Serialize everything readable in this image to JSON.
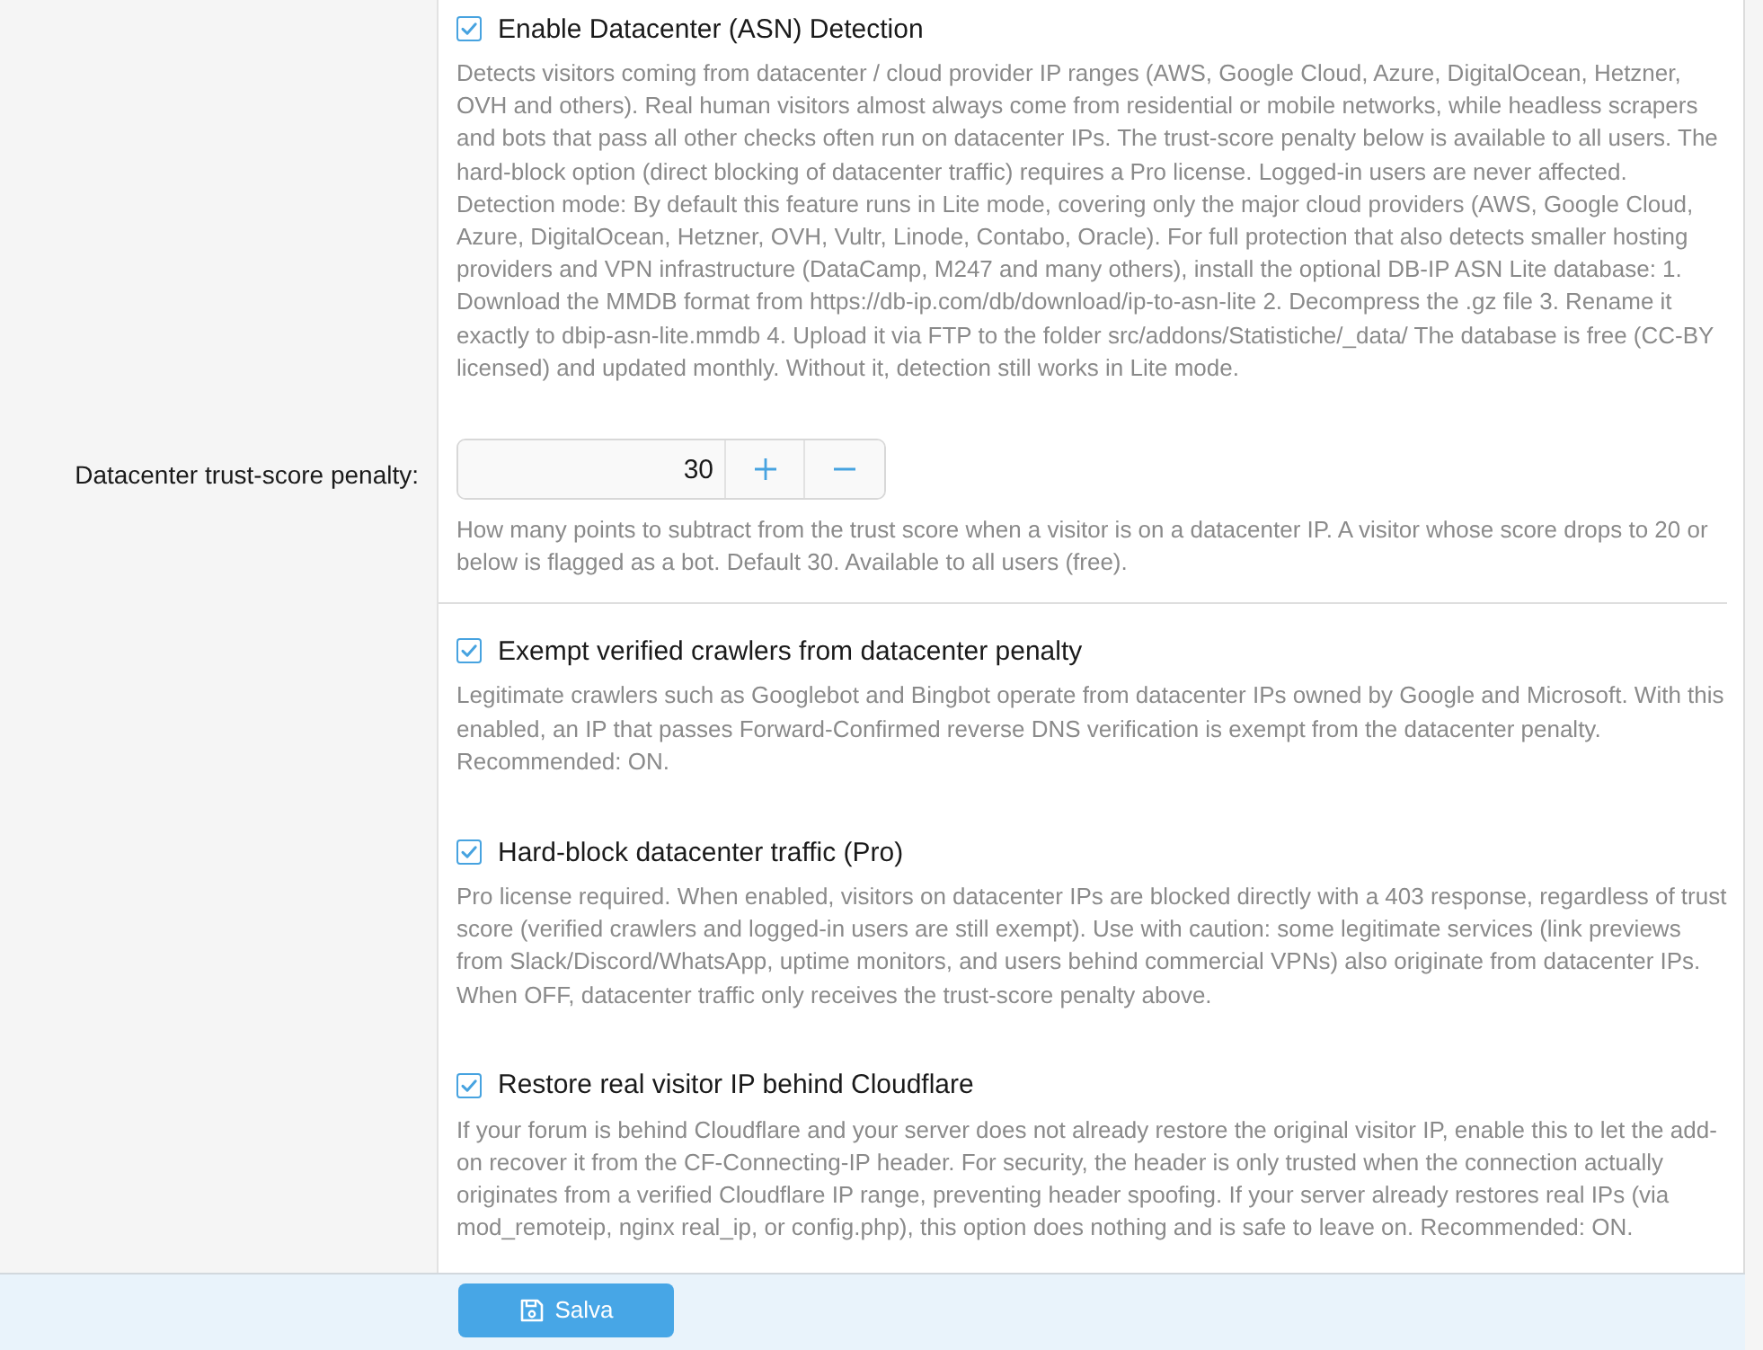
{
  "options": [
    {
      "kind": "checkbox",
      "label": "Enable Datacenter (ASN) Detection",
      "checked": true,
      "description": "Detects visitors coming from datacenter / cloud provider IP ranges (AWS, Google Cloud, Azure, DigitalOcean, Hetzner, OVH and others). Real human visitors almost always come from residential or mobile networks, while headless scrapers and bots that pass all other checks often run on datacenter IPs. The trust-score penalty below is available to all users. The hard-block option (direct blocking of datacenter traffic) requires a Pro license. Logged-in users are never affected. Detection mode: By default this feature runs in Lite mode, covering only the major cloud providers (AWS, Google Cloud, Azure, DigitalOcean, Hetzner, OVH, Vultr, Linode, Contabo, Oracle). For full protection that also detects smaller hosting providers and VPN infrastructure (DataCamp, M247 and many others), install the optional DB-IP ASN Lite database: 1. Download the MMDB format from https://db-ip.com/db/download/ip-to-asn-lite 2. Decompress the .gz file 3. Rename it exactly to dbip-asn-lite.mmdb 4. Upload it via FTP to the folder src/addons/Statistiche/_data/ The database is free (CC-BY licensed) and updated monthly. Without it, detection still works in Lite mode."
    },
    {
      "kind": "number",
      "label": "Datacenter trust-score penalty:",
      "value": "30",
      "description": "How many points to subtract from the trust score when a visitor is on a datacenter IP. A visitor whose score drops to 20 or below is flagged as a bot. Default 30. Available to all users (free)."
    },
    {
      "kind": "checkbox",
      "label": "Exempt verified crawlers from datacenter penalty",
      "checked": true,
      "description": "Legitimate crawlers such as Googlebot and Bingbot operate from datacenter IPs owned by Google and Microsoft. With this enabled, an IP that passes Forward-Confirmed reverse DNS verification is exempt from the datacenter penalty. Recommended: ON."
    },
    {
      "kind": "checkbox",
      "label": "Hard-block datacenter traffic (Pro)",
      "checked": true,
      "description": "Pro license required. When enabled, visitors on datacenter IPs are blocked directly with a 403 response, regardless of trust score (verified crawlers and logged-in users are still exempt). Use with caution: some legitimate services (link previews from Slack/Discord/WhatsApp, uptime monitors, and users behind commercial VPNs) also originate from datacenter IPs. When OFF, datacenter traffic only receives the trust-score penalty above."
    },
    {
      "kind": "checkbox",
      "label": "Restore real visitor IP behind Cloudflare",
      "checked": true,
      "description": "If your forum is behind Cloudflare and your server does not already restore the original visitor IP, enable this to let the add-on recover it from the CF-Connecting-IP header. For security, the header is only trusted when the connection actually originates from a verified Cloudflare IP range, preventing header spoofing. If your server already restores real IPs (via mod_remoteip, nginx real_ip, or config.php), this option does nothing and is safe to leave on. Recommended: ON."
    }
  ],
  "save_button": {
    "label": "Salva"
  }
}
